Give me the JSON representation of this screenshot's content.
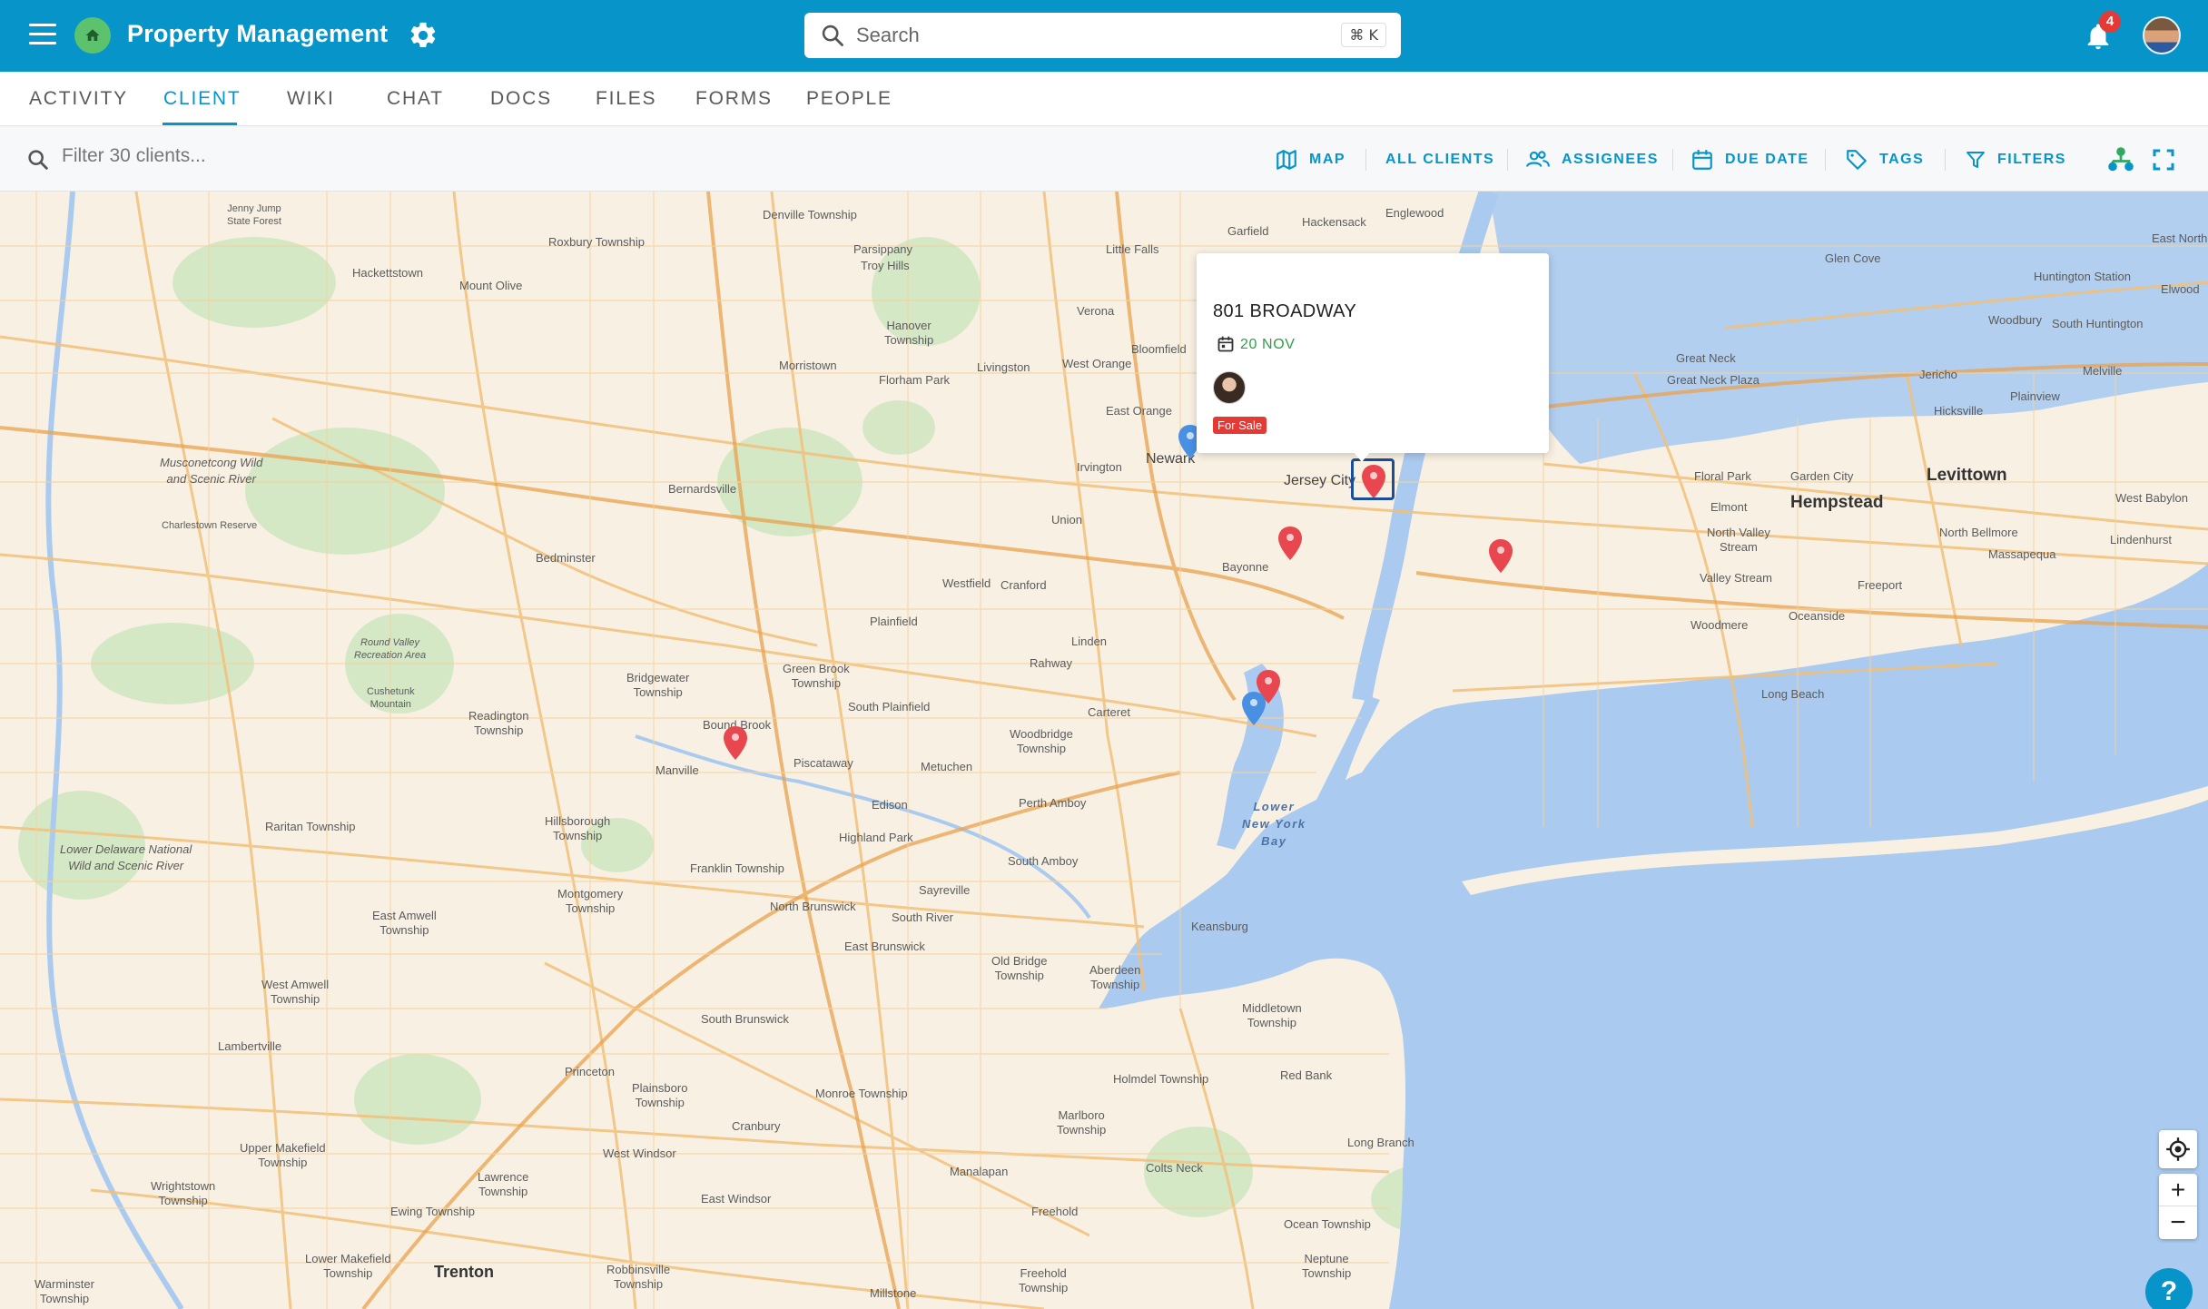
{
  "header": {
    "app_title": "Property Management",
    "search_placeholder": "Search",
    "search_shortcut": "⌘ K",
    "notification_count": "4",
    "icons": [
      "menu-icon",
      "home-icon",
      "gear-icon",
      "search-icon",
      "bell-icon",
      "user-avatar"
    ]
  },
  "tabs": [
    {
      "label": "ACTIVITY"
    },
    {
      "label": "CLIENT",
      "active": true
    },
    {
      "label": "WIKI"
    },
    {
      "label": "CHAT"
    },
    {
      "label": "DOCS"
    },
    {
      "label": "FILES"
    },
    {
      "label": "FORMS"
    },
    {
      "label": "PEOPLE"
    }
  ],
  "toolbar": {
    "filter_placeholder": "Filter 30 clients...",
    "map": "MAP",
    "all_clients": "ALL CLIENTS",
    "assignees": "ASSIGNEES",
    "due_date": "DUE DATE",
    "tags": "TAGS",
    "filters": "FILTERS"
  },
  "popup": {
    "title": "801 BROADWAY",
    "date": "20 NOV",
    "tag": "For Sale"
  },
  "map": {
    "places": {
      "jenny_jump": "Jenny Jump\nState Forest",
      "hackettstown": "Hackettstown",
      "roxbury": "Roxbury Township",
      "denville": "Denville Township",
      "parsippany": "Parsippany",
      "troy_hills": "Troy Hills",
      "mount_olive": "Mount Olive",
      "little_falls": "Little Falls",
      "garfield": "Garfield",
      "hackensack": "Hackensack",
      "englewood": "Englewood",
      "glen_cove": "Glen Cove",
      "huntington_station": "Huntington Station",
      "east_north": "East North",
      "elwood": "Elwood",
      "woodbury": "Woodbury",
      "south_huntington": "South Huntington",
      "hanover": "Hanover\nTownship",
      "verona": "Verona",
      "bloomfield": "Bloomfield",
      "west_orange": "West Orange",
      "livingston": "Livingston",
      "morristown": "Morristown",
      "florham_park": "Florham Park",
      "east_orange": "East Orange",
      "irvington": "Irvington",
      "newark": "Newark",
      "jersey_city": "Jersey City",
      "great_neck": "Great Neck",
      "great_neck_plaza": "Great Neck Plaza",
      "jericho": "Jericho",
      "melville": "Melville",
      "hicksville": "Hicksville",
      "plainview": "Plainview",
      "levittown": "Levittown",
      "hempstead": "Hempstead",
      "garden_city": "Garden City",
      "floral_park": "Floral Park",
      "elmont": "Elmont",
      "west_babylon": "West Babylon",
      "north_valley_stream": "North Valley\nStream",
      "valley_stream": "Valley Stream",
      "north_bellmore": "North Bellmore",
      "massapequa": "Massapequa",
      "lindenhurst": "Lindenhurst",
      "freeport": "Freeport",
      "oceanside": "Oceanside",
      "woodmere": "Woodmere",
      "long_beach": "Long Beach",
      "musconetcong": "Musconetcong Wild\nand Scenic River",
      "bernardsville": "Bernardsville",
      "charlestown": "Charlestown Reserve",
      "bedminster": "Bedminster",
      "union": "Union",
      "bayonne": "Bayonne",
      "westfield": "Westfield",
      "cranford": "Cranford",
      "plainfield": "Plainfield",
      "linden": "Linden",
      "rahway": "Rahway",
      "round_valley": "Round Valley\nRecreation Area",
      "cushetunk": "Cushetunk\nMountain",
      "bridgewater": "Bridgewater\nTownship",
      "green_brook": "Green Brook\nTownship",
      "south_plainfield": "South Plainfield",
      "readington": "Readington\nTownship",
      "bound_brook": "Bound Brook",
      "manville": "Manville",
      "piscataway": "Piscataway",
      "woodbridge": "Woodbridge\nTownship",
      "carteret": "Carteret",
      "metuchen": "Metuchen",
      "edison": "Edison",
      "perth_amboy": "Perth Amboy",
      "raritan_township": "Raritan Township",
      "hillsborough": "Hillsborough\nTownship",
      "highland_park": "Highland Park",
      "south_amboy": "South Amboy",
      "franklin_township": "Franklin Township",
      "sayreville": "Sayreville",
      "south_river": "South River",
      "north_brunswick": "North Brunswick",
      "lower_delaware": "Lower Delaware National\nWild and Scenic River",
      "montgomery": "Montgomery\nTownship",
      "east_amwell": "East Amwell\nTownship",
      "east_brunswick": "East Brunswick",
      "old_bridge": "Old Bridge\nTownship",
      "aberdeen": "Aberdeen\nTownship",
      "keansburg": "Keansburg",
      "middletown": "Middletown\nTownship",
      "west_amwell": "West Amwell\nTownship",
      "lambertville": "Lambertville",
      "south_brunswick": "South Brunswick",
      "princeton": "Princeton",
      "plainsboro": "Plainsboro\nTownship",
      "monroe": "Monroe Township",
      "holmdel": "Holmdel Township",
      "red_bank": "Red Bank",
      "marlboro": "Marlboro\nTownship",
      "upper_makefield": "Upper Makefield\nTownship",
      "cranbury": "Cranbury",
      "west_windsor": "West Windsor",
      "lawrence": "Lawrence\nTownship",
      "manalapan": "Manalapan",
      "colts_neck": "Colts Neck",
      "long_branch": "Long Branch",
      "wrightstown": "Wrightstown\nTownship",
      "ewing": "Ewing Township",
      "east_windsor": "East Windsor",
      "freehold": "Freehold",
      "ocean_township": "Ocean Township",
      "trenton": "Trenton",
      "lower_makefield": "Lower Makefield\nTownship",
      "robbinsville": "Robbinsville\nTownship",
      "freehold_township": "Freehold\nTownship",
      "neptune": "Neptune\nTownship",
      "millstone": "Millstone",
      "warminster": "Warminster\nTownship"
    },
    "water_lower_bay": "Lower\nNew York\nBay",
    "pins": [
      {
        "color": "#e8474f",
        "name": "pin-801-broadway"
      },
      {
        "color": "#e8474f",
        "name": "pin-bayonne"
      },
      {
        "color": "#e8474f",
        "name": "pin-queens"
      },
      {
        "color": "#e8474f",
        "name": "pin-staten-island"
      },
      {
        "color": "#4a90e2",
        "name": "pin-staten-island-blue"
      },
      {
        "color": "#e8474f",
        "name": "pin-bound-brook"
      },
      {
        "color": "#4a90e2",
        "name": "pin-newark"
      }
    ]
  }
}
